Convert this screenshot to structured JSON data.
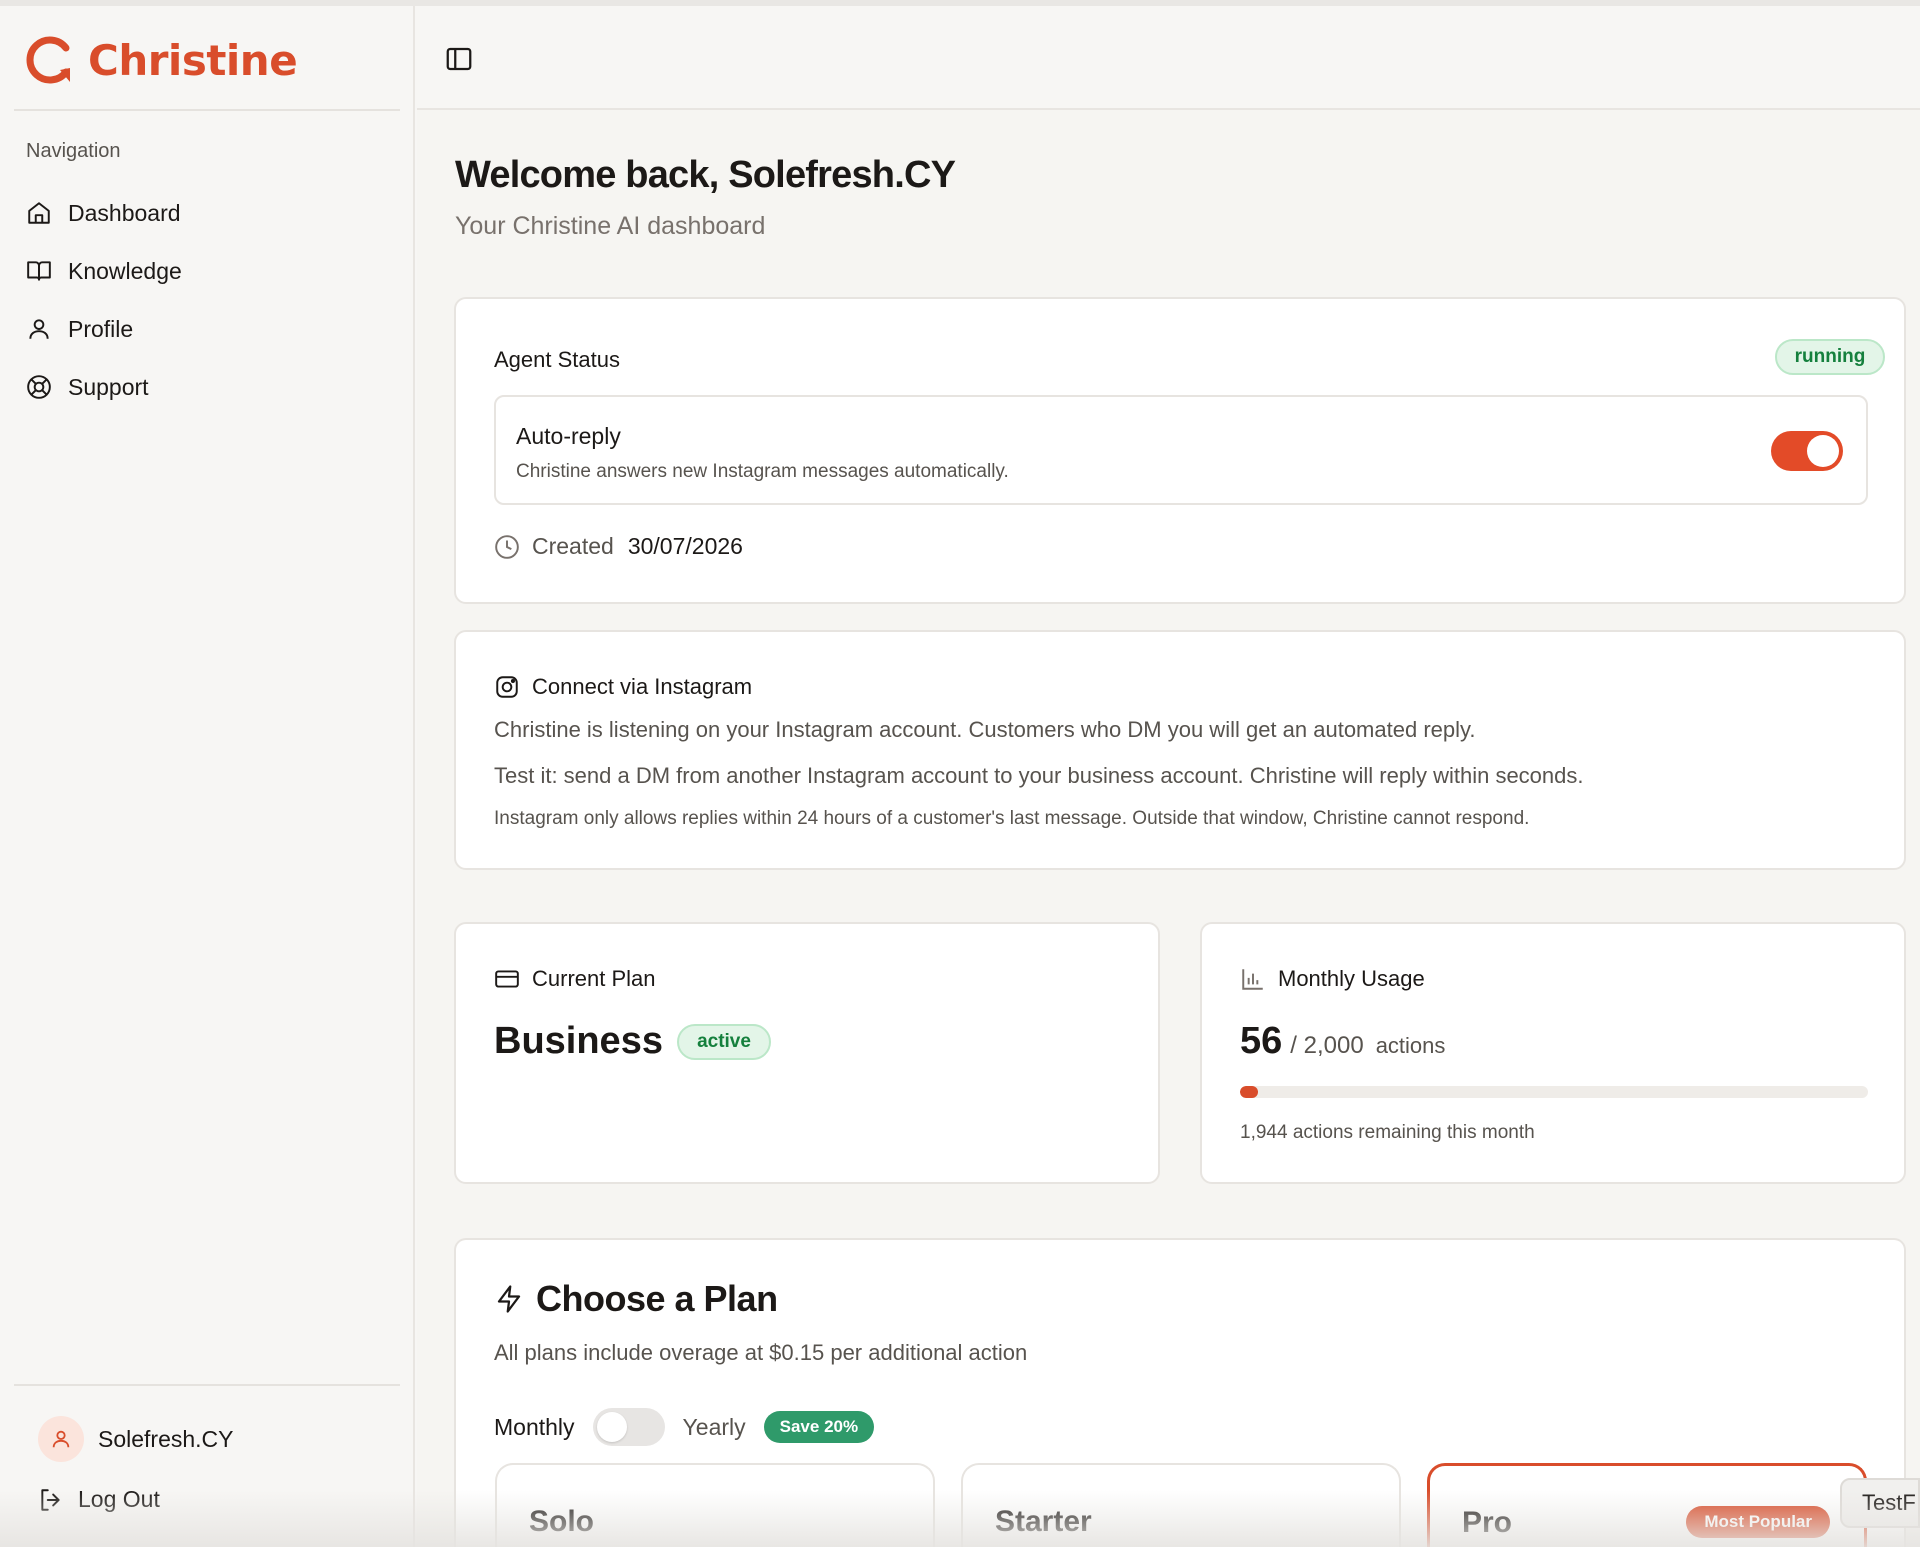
{
  "brand": {
    "name": "Christine",
    "color": "#d94d2b"
  },
  "sidebar": {
    "nav_heading": "Navigation",
    "items": [
      {
        "label": "Dashboard",
        "icon": "home-icon"
      },
      {
        "label": "Knowledge",
        "icon": "book-icon"
      },
      {
        "label": "Profile",
        "icon": "user-icon"
      },
      {
        "label": "Support",
        "icon": "lifebuoy-icon"
      }
    ],
    "user_name": "Solefresh.CY",
    "logout_label": "Log Out"
  },
  "header": {
    "title": "Welcome back, Solefresh.CY",
    "subtitle": "Your Christine AI dashboard"
  },
  "agent_status": {
    "label": "Agent Status",
    "status": "running",
    "auto_reply_title": "Auto-reply",
    "auto_reply_desc": "Christine answers new Instagram messages automatically.",
    "auto_reply_on": true,
    "created_label": "Created",
    "created_date": "30/07/2026"
  },
  "instagram": {
    "title": "Connect via Instagram",
    "line1": "Christine is listening on your Instagram account. Customers who DM you will get an automated reply.",
    "line2": "Test it: send a DM from another Instagram account to your business account. Christine will reply within seconds.",
    "note": "Instagram only allows replies within 24 hours of a customer's last message. Outside that window, Christine cannot respond."
  },
  "current_plan": {
    "label": "Current Plan",
    "name": "Business",
    "status": "active"
  },
  "usage": {
    "label": "Monthly Usage",
    "used": "56",
    "limit": "/ 2,000",
    "unit": "actions",
    "used_fraction": 0.028,
    "remaining_text": "1,944 actions remaining this month"
  },
  "choose_plan": {
    "title": "Choose a Plan",
    "subtitle": "All plans include overage at $0.15 per additional action",
    "monthly_label": "Monthly",
    "yearly_label": "Yearly",
    "save_label": "Save 20%",
    "plans": [
      {
        "name": "Solo"
      },
      {
        "name": "Starter"
      },
      {
        "name": "Pro",
        "badge": "Most Popular"
      }
    ]
  },
  "side_tab": {
    "label": "TestF"
  }
}
